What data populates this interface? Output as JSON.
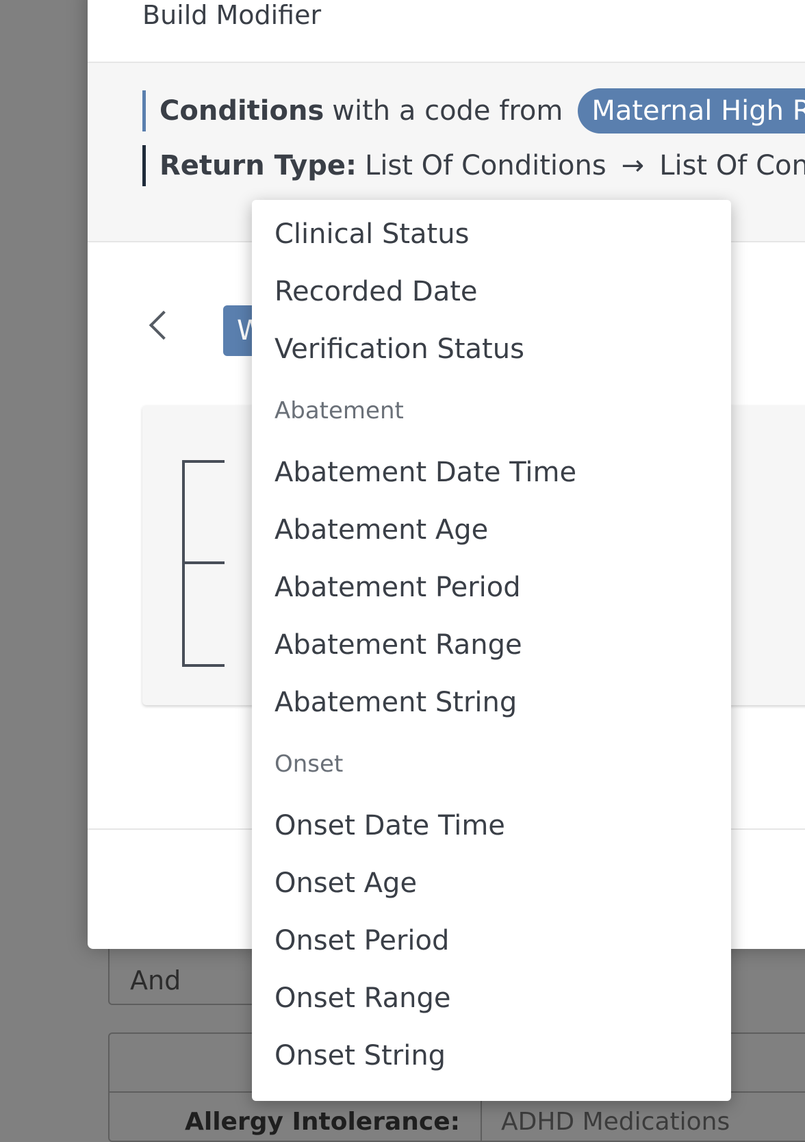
{
  "background": {
    "and_label": "And",
    "card_label": "Allergy Intolerance:",
    "card_value": "ADHD Medications"
  },
  "modal": {
    "title": "Build Modifier",
    "summary": {
      "resource": "Conditions",
      "code_text": "with a code from",
      "valueset": "Maternal High Risk",
      "return_label": "Return Type:",
      "return_from": "List Of Conditions",
      "arrow": "→",
      "return_to": "List Of Condit"
    },
    "where_button": "W"
  },
  "menu": {
    "items_top": [
      "Clinical Status",
      "Recorded Date",
      "Verification Status"
    ],
    "groups": [
      {
        "label": "Abatement",
        "items": [
          "Abatement Date Time",
          "Abatement Age",
          "Abatement Period",
          "Abatement Range",
          "Abatement String"
        ]
      },
      {
        "label": "Onset",
        "items": [
          "Onset Date Time",
          "Onset Age",
          "Onset Period",
          "Onset Range",
          "Onset String"
        ]
      }
    ]
  },
  "colors": {
    "accent": "#5a7fae",
    "overlay": "#808080",
    "text": "#3a3f47"
  }
}
